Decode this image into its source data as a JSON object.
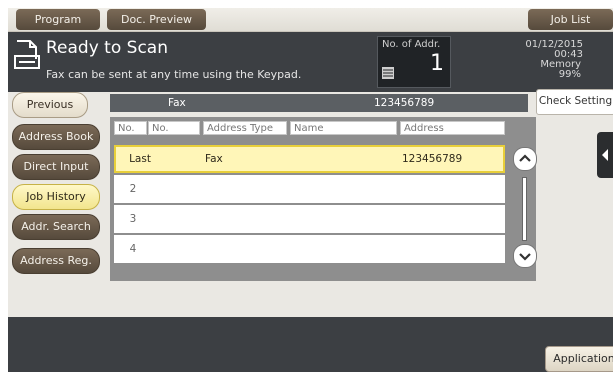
{
  "top_bar": {
    "program_label": "Program",
    "doc_preview_label": "Doc. Preview",
    "job_list_label": "Job List"
  },
  "header": {
    "title": "Ready to Scan",
    "subtitle": "Fax can be sent at any time using the Keypad.",
    "addr_label": "No. of Addr.",
    "addr_count": "1",
    "date": "01/12/2015",
    "time": "00:43",
    "memory_label": "Memory",
    "memory_value": "99%"
  },
  "left_buttons": {
    "previous": "Previous",
    "address_book": "Address Book",
    "direct_input": "Direct Input",
    "job_history": "Job History",
    "addr_search": "Addr. Search",
    "address_reg": "Address Reg."
  },
  "check_setting_label": "Check Setting",
  "selected_bar": {
    "type": "Fax",
    "number": "123456789"
  },
  "table": {
    "headers": [
      "No.",
      "No.",
      "Address Type",
      "Name",
      "Address"
    ],
    "rows": [
      {
        "no": "Last",
        "type": "Fax",
        "name": "",
        "address": "123456789"
      },
      {
        "no": "2",
        "type": "",
        "name": "",
        "address": ""
      },
      {
        "no": "3",
        "type": "",
        "name": "",
        "address": ""
      },
      {
        "no": "4",
        "type": "",
        "name": "",
        "address": ""
      }
    ]
  },
  "application_label": "Application",
  "icons": [
    "scan-icon",
    "address-list-icon",
    "scroll-up-icon",
    "scroll-down-icon",
    "side-panel-tab-icon"
  ],
  "colors": {
    "header_bg": "#3c3f43",
    "button_brown": "#6b5b49",
    "selected_yellow": "#fff6b8"
  }
}
